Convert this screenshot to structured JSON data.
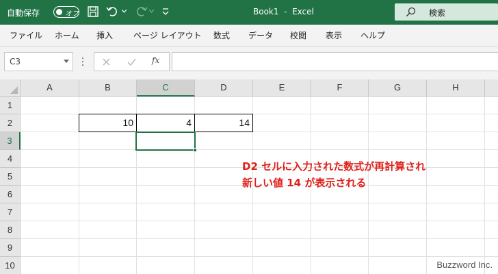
{
  "titlebar": {
    "autosave_label": "自動保存",
    "autosave_state": "オフ",
    "document_title": "Book1  -  Excel",
    "search_label": "検索",
    "bg_color": "#217346"
  },
  "ribbon": {
    "tabs": [
      {
        "label": "ファイル"
      },
      {
        "label": "ホーム"
      },
      {
        "label": "挿入"
      },
      {
        "label": "ページ レイアウト"
      },
      {
        "label": "数式"
      },
      {
        "label": "データ"
      },
      {
        "label": "校閲"
      },
      {
        "label": "表示"
      },
      {
        "label": "ヘルプ"
      }
    ]
  },
  "formula_bar": {
    "name_box": "C3",
    "fx_label": "fx",
    "formula": ""
  },
  "sheet": {
    "columns": [
      "A",
      "B",
      "C",
      "D",
      "E",
      "F",
      "G",
      "H"
    ],
    "rows": [
      "1",
      "2",
      "3",
      "4",
      "5",
      "6",
      "7",
      "8",
      "9",
      "10"
    ],
    "selected_column": "C",
    "selected_row": "3",
    "active_cell": "C3",
    "values": {
      "B2": "10",
      "C2": "4",
      "D2": "14"
    }
  },
  "annotation": {
    "line1": "D2 セルに入力された数式が再計算され",
    "line2": "新しい値 14 が表示される",
    "color": "#e0201b"
  },
  "watermark": "Buzzword Inc."
}
